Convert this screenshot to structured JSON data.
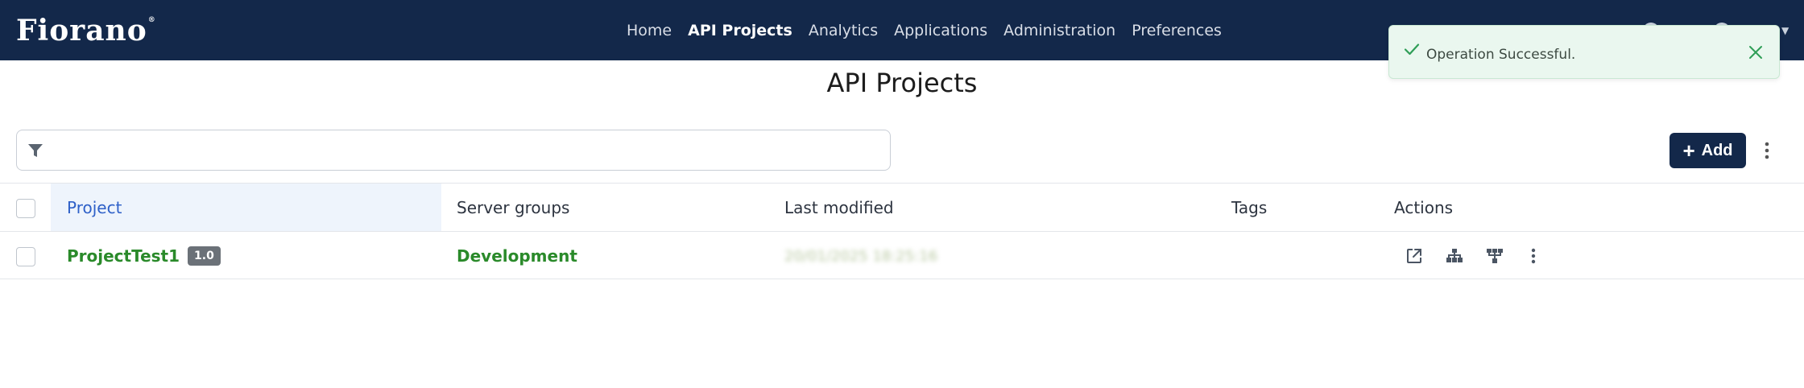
{
  "brand": {
    "name": "Fiorano",
    "mark": "®"
  },
  "nav": {
    "links": [
      {
        "label": "Home"
      },
      {
        "label": "API Projects"
      },
      {
        "label": "Analytics"
      },
      {
        "label": "Applications"
      },
      {
        "label": "Administration"
      },
      {
        "label": "Preferences"
      }
    ],
    "active": "API Projects"
  },
  "toast": {
    "message": "Operation Successful.",
    "type": "success"
  },
  "page": {
    "title": "API Projects"
  },
  "filter": {
    "placeholder": "",
    "value": ""
  },
  "toolbar": {
    "add_label": "Add"
  },
  "table": {
    "columns": [
      "Project",
      "Server groups",
      "Last modified",
      "Tags",
      "Actions"
    ],
    "rows": [
      {
        "project": "ProjectTest1",
        "version": "1.0",
        "server_group": "Development",
        "last_modified": "20/01/2025 18:25:16",
        "tags": "",
        "actions": [
          "open-external-icon",
          "hierarchy-icon",
          "deploy-icon",
          "more-vert-icon"
        ]
      }
    ]
  },
  "colors": {
    "navbar": "#13284a",
    "accent_link": "#2a8a2a",
    "header_active": "#2e60c8",
    "toast_bg": "#eaf7ef",
    "success": "#2f9e57"
  }
}
